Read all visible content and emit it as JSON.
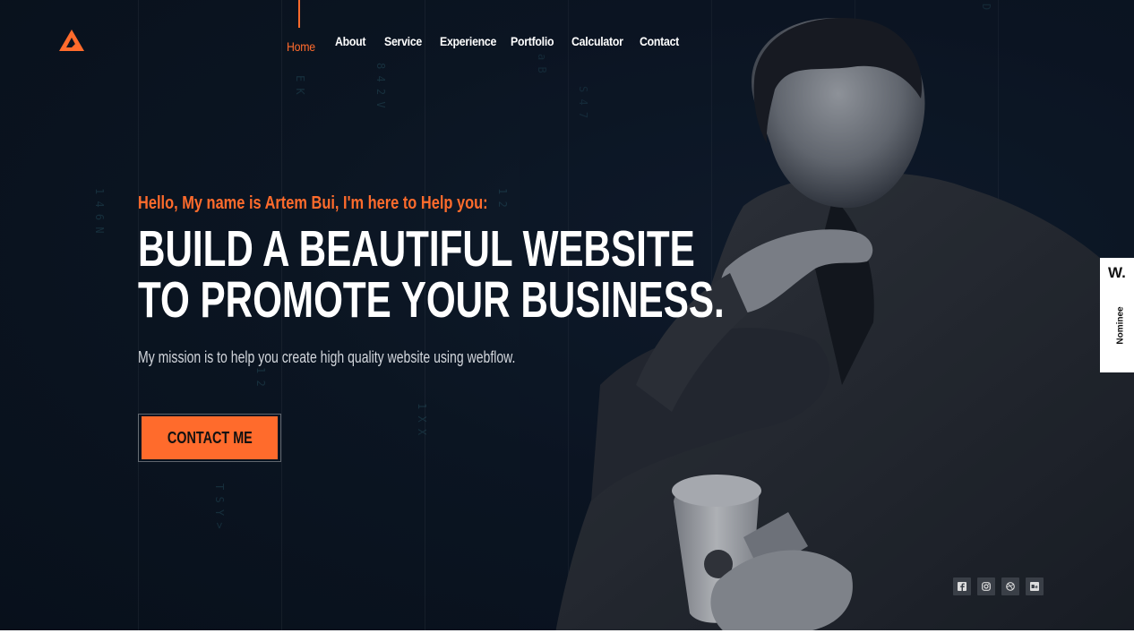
{
  "brand": {
    "logo_icon": "triangle-logo-icon",
    "accent": "#ff6b2c"
  },
  "nav": {
    "items": [
      {
        "label": "Home",
        "active": true
      },
      {
        "label": "About"
      },
      {
        "label": "Service"
      },
      {
        "label": "Experience"
      },
      {
        "label": "Portfolio"
      },
      {
        "label": "Calculator"
      },
      {
        "label": "Contact"
      }
    ]
  },
  "hero": {
    "greeting": "Hello, My name is Artem Bui, I'm here to Help you:",
    "headline_line1": "BUILD A BEAUTIFUL WEBSITE",
    "headline_line2": "TO PROMOTE YOUR BUSINESS.",
    "mission": "My mission is to help you create high quality website using webflow.",
    "cta_label": "CONTACT ME"
  },
  "badge": {
    "mark": "W.",
    "label": "Nominee"
  },
  "socials": [
    {
      "icon": "facebook-icon"
    },
    {
      "icon": "instagram-icon"
    },
    {
      "icon": "dribbble-icon"
    },
    {
      "icon": "behance-icon"
    }
  ],
  "colors": {
    "background": "#0a1320",
    "accent": "#ff6b2c",
    "text": "#ffffff",
    "muted": "#d2d6dc"
  }
}
